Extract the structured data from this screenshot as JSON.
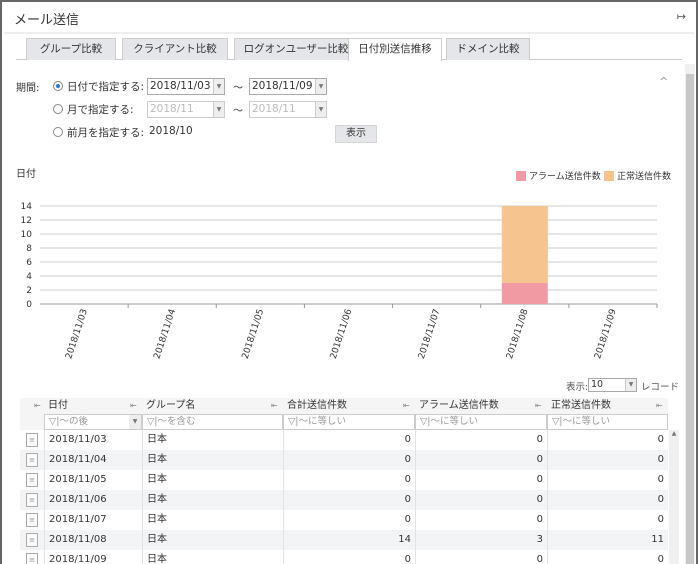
{
  "header": {
    "title": "メール送信",
    "exit_icon": "exit-icon"
  },
  "tabs": [
    {
      "label": "グループ比較"
    },
    {
      "label": "クライアント比較"
    },
    {
      "label": "ログオンユーザー比較"
    },
    {
      "label": "日付別送信推移",
      "active": true
    },
    {
      "label": "ドメイン比較"
    }
  ],
  "period": {
    "label": "期間:",
    "options": [
      {
        "label": "日付で指定する:",
        "selected": true,
        "from": "2018/11/03",
        "to": "2018/11/09"
      },
      {
        "label": "月で指定する:",
        "selected": false,
        "from": "2018/11",
        "to": "2018/11"
      },
      {
        "label": "前月を指定する:",
        "selected": false,
        "value": "2018/10"
      }
    ],
    "tilde": "～",
    "show_button": "表示"
  },
  "chart_data": {
    "type": "bar",
    "stacked": true,
    "ylabel": "日付",
    "categories": [
      "2018/11/03",
      "2018/11/04",
      "2018/11/05",
      "2018/11/06",
      "2018/11/07",
      "2018/11/08",
      "2018/11/09"
    ],
    "series": [
      {
        "name": "アラーム送信件数",
        "color": "#f29aa4",
        "values": [
          0,
          0,
          0,
          0,
          0,
          3,
          0
        ]
      },
      {
        "name": "正常送信件数",
        "color": "#f5c48f",
        "values": [
          0,
          0,
          0,
          0,
          0,
          11,
          0
        ]
      }
    ],
    "ylim": [
      0,
      14
    ],
    "yticks": [
      0,
      2,
      4,
      6,
      8,
      10,
      12,
      14
    ],
    "legend": "top-right",
    "grid": true
  },
  "table": {
    "page_size_label": "表示:",
    "page_size": "10",
    "records_label": "レコード",
    "columns": [
      "日付",
      "グループ名",
      "合計送信件数",
      "アラーム送信件数",
      "正常送信件数"
    ],
    "filters": [
      "～の後",
      "～を含む",
      "～に等しい",
      "～に等しい",
      "～に等しい"
    ],
    "rows": [
      [
        "2018/11/03",
        "日本",
        "0",
        "0",
        "0"
      ],
      [
        "2018/11/04",
        "日本",
        "0",
        "0",
        "0"
      ],
      [
        "2018/11/05",
        "日本",
        "0",
        "0",
        "0"
      ],
      [
        "2018/11/06",
        "日本",
        "0",
        "0",
        "0"
      ],
      [
        "2018/11/07",
        "日本",
        "0",
        "0",
        "0"
      ],
      [
        "2018/11/08",
        "日本",
        "14",
        "3",
        "11"
      ],
      [
        "2018/11/09",
        "日本",
        "0",
        "0",
        "0"
      ]
    ]
  }
}
